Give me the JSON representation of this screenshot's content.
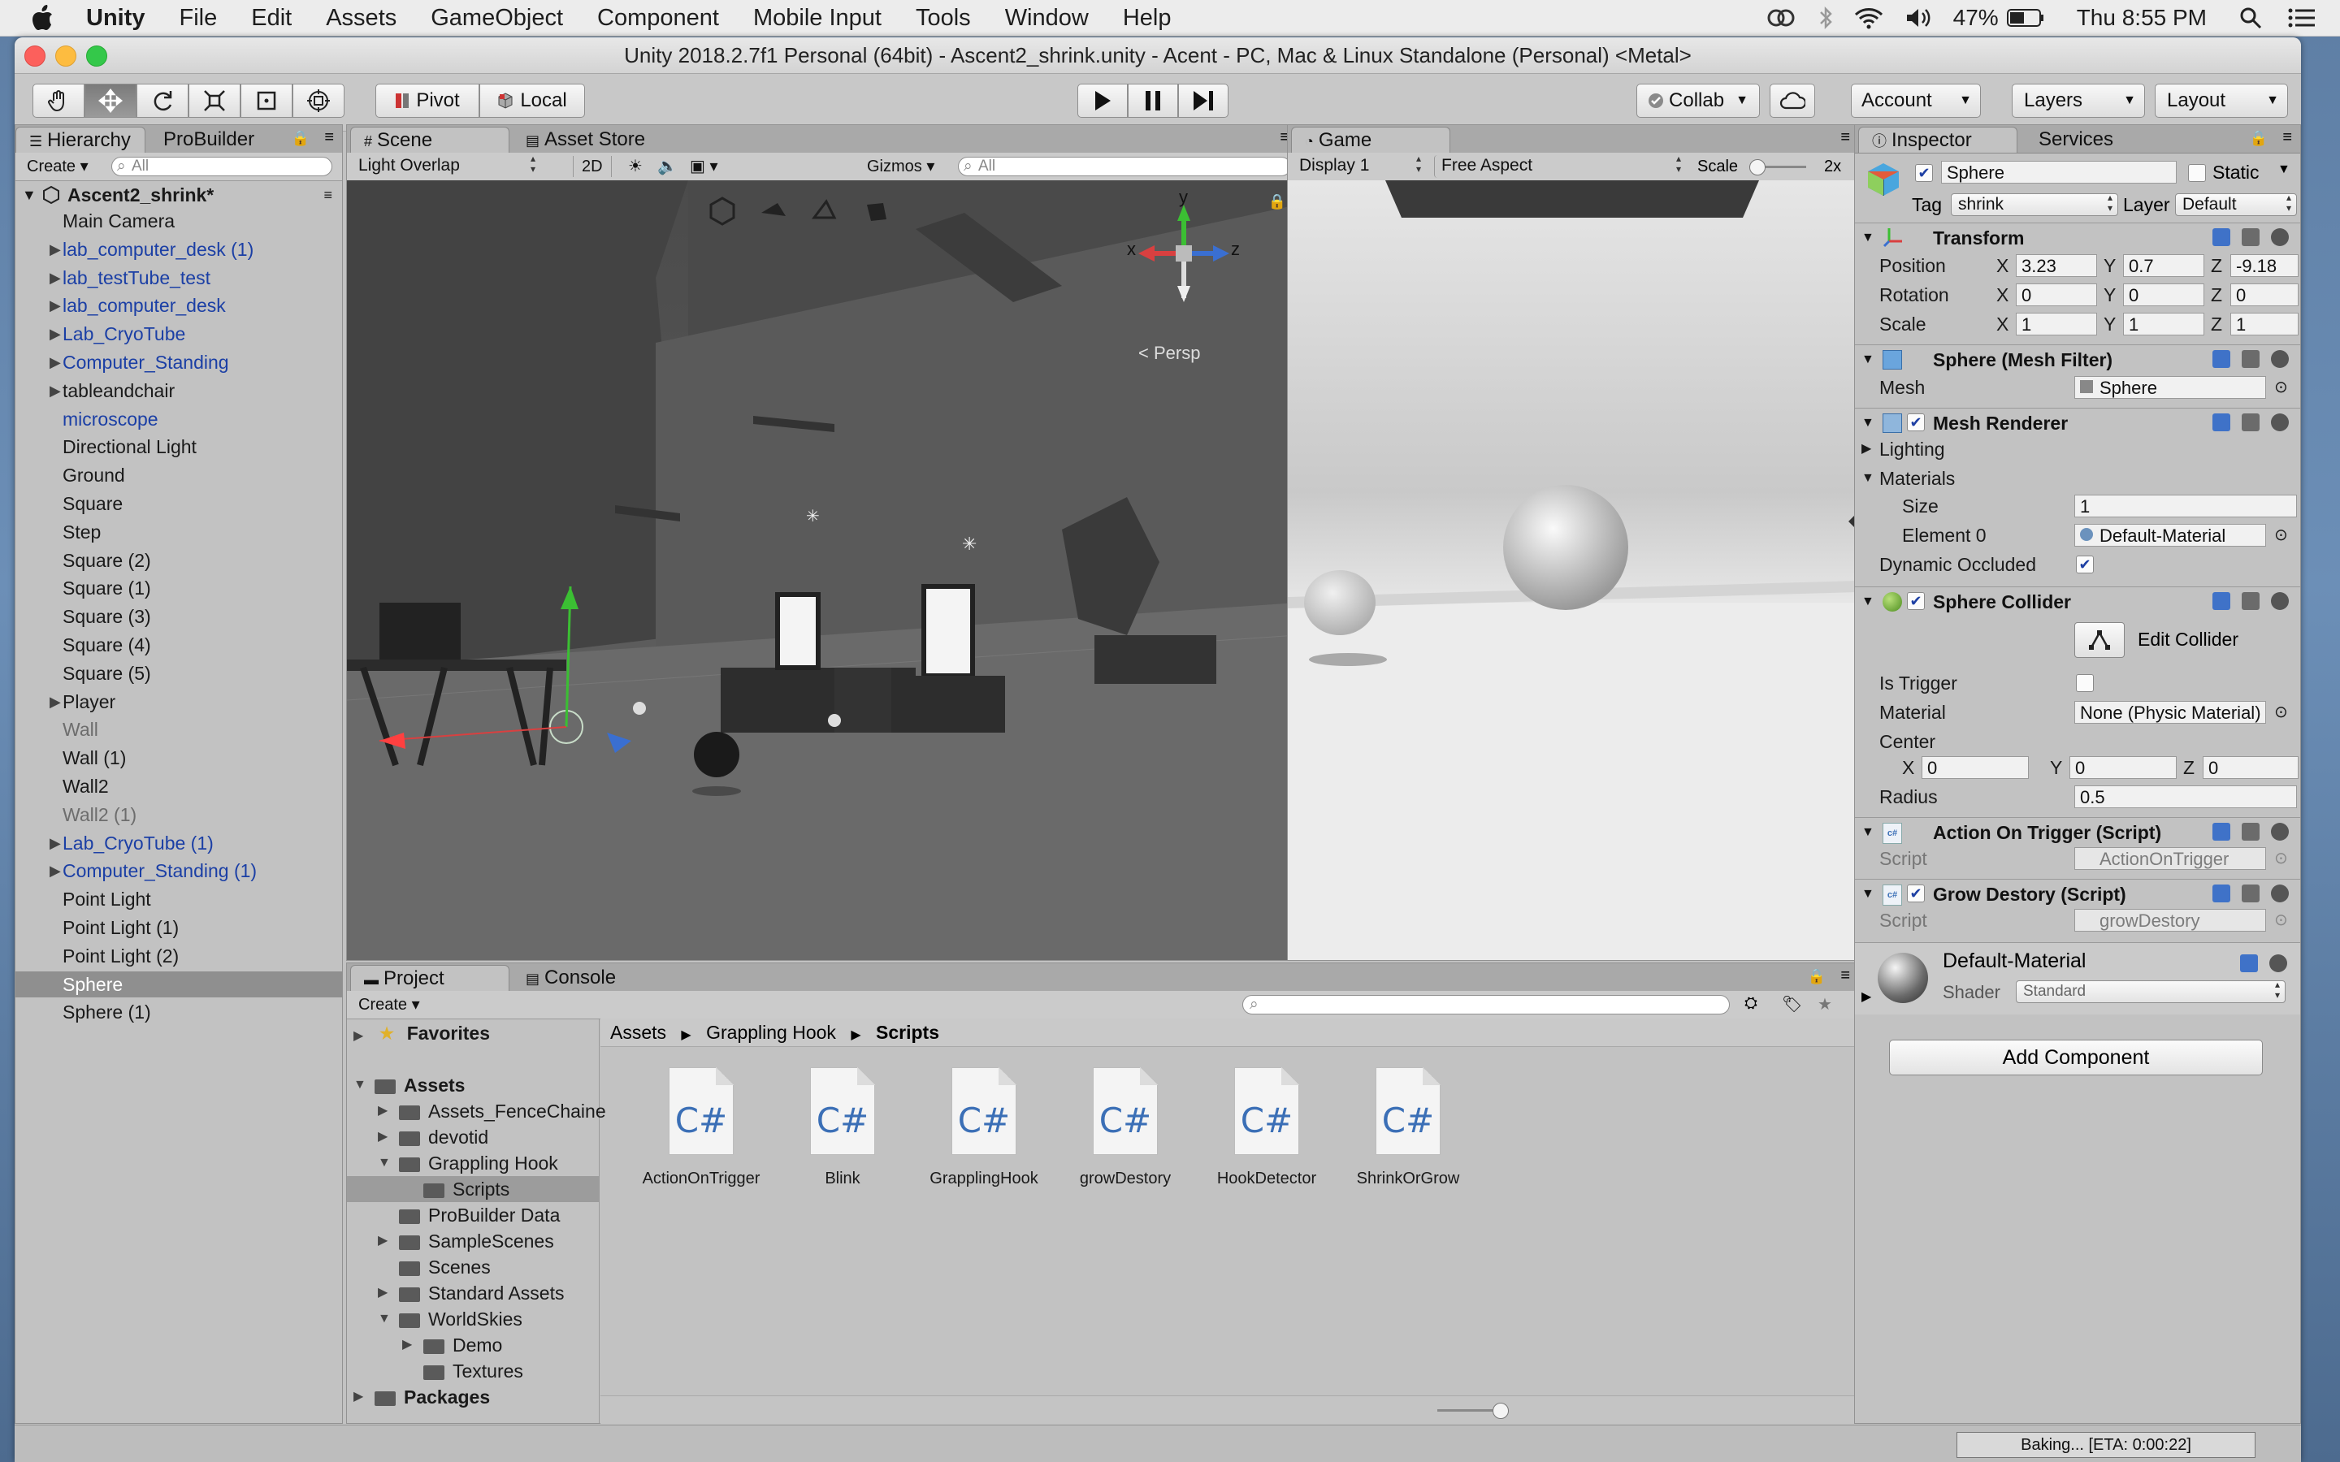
{
  "menubar": {
    "app": "Unity",
    "items": [
      "File",
      "Edit",
      "Assets",
      "GameObject",
      "Component",
      "Mobile Input",
      "Tools",
      "Window",
      "Help"
    ],
    "battery": "47%",
    "clock": "Thu 8:55 PM"
  },
  "window": {
    "title": "Unity 2018.2.7f1 Personal (64bit) - Ascent2_shrink.unity - Acent - PC, Mac & Linux Standalone (Personal) <Metal>"
  },
  "toolbar": {
    "pivot": "Pivot",
    "local": "Local",
    "collab": "Collab",
    "account": "Account",
    "layers": "Layers",
    "layout": "Layout"
  },
  "hierarchy": {
    "tabs": [
      "Hierarchy",
      "ProBuilder"
    ],
    "create": "Create",
    "search_placeholder": "All",
    "scene_name": "Ascent2_shrink*",
    "items": [
      {
        "label": "Main Camera",
        "kind": "normal",
        "arrow": false
      },
      {
        "label": "lab_computer_desk (1)",
        "kind": "prefab",
        "arrow": true
      },
      {
        "label": "lab_testTube_test",
        "kind": "prefab",
        "arrow": true
      },
      {
        "label": "lab_computer_desk",
        "kind": "prefab",
        "arrow": true
      },
      {
        "label": "Lab_CryoTube",
        "kind": "prefab",
        "arrow": true
      },
      {
        "label": "Computer_Standing",
        "kind": "prefab",
        "arrow": true
      },
      {
        "label": "tableandchair",
        "kind": "normal",
        "arrow": true
      },
      {
        "label": "microscope",
        "kind": "prefab",
        "arrow": false
      },
      {
        "label": "Directional Light",
        "kind": "normal",
        "arrow": false
      },
      {
        "label": "Ground",
        "kind": "normal",
        "arrow": false
      },
      {
        "label": "Square",
        "kind": "normal",
        "arrow": false
      },
      {
        "label": "Step",
        "kind": "normal",
        "arrow": false
      },
      {
        "label": "Square (2)",
        "kind": "normal",
        "arrow": false
      },
      {
        "label": "Square (1)",
        "kind": "normal",
        "arrow": false
      },
      {
        "label": "Square (3)",
        "kind": "normal",
        "arrow": false
      },
      {
        "label": "Square (4)",
        "kind": "normal",
        "arrow": false
      },
      {
        "label": "Square (5)",
        "kind": "normal",
        "arrow": false
      },
      {
        "label": "Player",
        "kind": "normal",
        "arrow": true
      },
      {
        "label": "Wall",
        "kind": "disabled",
        "arrow": false
      },
      {
        "label": "Wall (1)",
        "kind": "normal",
        "arrow": false
      },
      {
        "label": "Wall2",
        "kind": "normal",
        "arrow": false
      },
      {
        "label": "Wall2 (1)",
        "kind": "disabled",
        "arrow": false
      },
      {
        "label": "Lab_CryoTube (1)",
        "kind": "prefab",
        "arrow": true
      },
      {
        "label": "Computer_Standing (1)",
        "kind": "prefab",
        "arrow": true
      },
      {
        "label": "Point Light",
        "kind": "normal",
        "arrow": false
      },
      {
        "label": "Point Light (1)",
        "kind": "normal",
        "arrow": false
      },
      {
        "label": "Point Light (2)",
        "kind": "normal",
        "arrow": false
      },
      {
        "label": "Sphere",
        "kind": "selected",
        "arrow": false
      },
      {
        "label": "Sphere (1)",
        "kind": "normal",
        "arrow": false
      }
    ]
  },
  "scene": {
    "tabs": [
      "Scene",
      "Asset Store"
    ],
    "shading": "Light Overlap",
    "mode_2d": "2D",
    "gizmos": "Gizmos",
    "search_placeholder": "All",
    "persp": "Persp",
    "axes": {
      "x": "x",
      "y": "y",
      "z": "z"
    }
  },
  "game": {
    "tab": "Game",
    "display": "Display 1",
    "aspect": "Free Aspect",
    "scale_label": "Scale",
    "scale_value": "2x"
  },
  "project": {
    "tabs": [
      "Project",
      "Console"
    ],
    "create": "Create",
    "favorites": "Favorites",
    "tree": [
      {
        "label": "Assets",
        "indent": 0,
        "arrow": "open",
        "bold": true
      },
      {
        "label": "Assets_FenceChaine",
        "indent": 1,
        "arrow": "closed",
        "bold": false
      },
      {
        "label": "devotid",
        "indent": 1,
        "arrow": "closed",
        "bold": false
      },
      {
        "label": "Grappling Hook",
        "indent": 1,
        "arrow": "open",
        "bold": false
      },
      {
        "label": "Scripts",
        "indent": 2,
        "arrow": "none",
        "bold": false,
        "selected": true
      },
      {
        "label": "ProBuilder Data",
        "indent": 1,
        "arrow": "none",
        "bold": false
      },
      {
        "label": "SampleScenes",
        "indent": 1,
        "arrow": "closed",
        "bold": false
      },
      {
        "label": "Scenes",
        "indent": 1,
        "arrow": "none",
        "bold": false
      },
      {
        "label": "Standard Assets",
        "indent": 1,
        "arrow": "closed",
        "bold": false
      },
      {
        "label": "WorldSkies",
        "indent": 1,
        "arrow": "open",
        "bold": false
      },
      {
        "label": "Demo",
        "indent": 2,
        "arrow": "closed",
        "bold": false
      },
      {
        "label": "Textures",
        "indent": 2,
        "arrow": "none",
        "bold": false
      },
      {
        "label": "Packages",
        "indent": 0,
        "arrow": "closed",
        "bold": true
      }
    ],
    "breadcrumb": [
      "Assets",
      "Grappling Hook",
      "Scripts"
    ],
    "file_glyph": "C#",
    "files": [
      "ActionOnTrigger",
      "Blink",
      "GrapplingHook",
      "growDestory",
      "HookDetector",
      "ShrinkOrGrow"
    ]
  },
  "inspector": {
    "tabs": [
      "Inspector",
      "Services"
    ],
    "object_name": "Sphere",
    "static_label": "Static",
    "tag_label": "Tag",
    "tag_value": "shrink",
    "layer_label": "Layer",
    "layer_value": "Default",
    "transform": {
      "title": "Transform",
      "position_label": "Position",
      "rotation_label": "Rotation",
      "scale_label": "Scale",
      "position": {
        "x": "3.23",
        "y": "0.7",
        "z": "-9.18"
      },
      "rotation": {
        "x": "0",
        "y": "0",
        "z": "0"
      },
      "scale": {
        "x": "1",
        "y": "1",
        "z": "1"
      }
    },
    "mesh_filter": {
      "title": "Sphere (Mesh Filter)",
      "mesh_label": "Mesh",
      "mesh_value": "Sphere"
    },
    "mesh_renderer": {
      "title": "Mesh Renderer",
      "lighting": "Lighting",
      "materials": "Materials",
      "size_label": "Size",
      "size_value": "1",
      "element_label": "Element 0",
      "element_value": "Default-Material",
      "dynamic_occluded": "Dynamic Occluded"
    },
    "sphere_collider": {
      "title": "Sphere Collider",
      "edit_collider": "Edit Collider",
      "is_trigger": "Is Trigger",
      "material_label": "Material",
      "material_value": "None (Physic Material)",
      "center_label": "Center",
      "center": {
        "x": "0",
        "y": "0",
        "z": "0"
      },
      "radius_label": "Radius",
      "radius_value": "0.5"
    },
    "action_on_trigger": {
      "title": "Action On Trigger (Script)",
      "script_label": "Script",
      "script_value": "ActionOnTrigger"
    },
    "grow_destory": {
      "title": "Grow Destory (Script)",
      "script_label": "Script",
      "script_value": "growDestory"
    },
    "material": {
      "name": "Default-Material",
      "shader_label": "Shader",
      "shader_value": "Standard"
    },
    "add_component": "Add Component"
  },
  "statusbar": {
    "baking": "Baking... [ETA: 0:00:22]",
    "baking_progress": 0.0
  }
}
